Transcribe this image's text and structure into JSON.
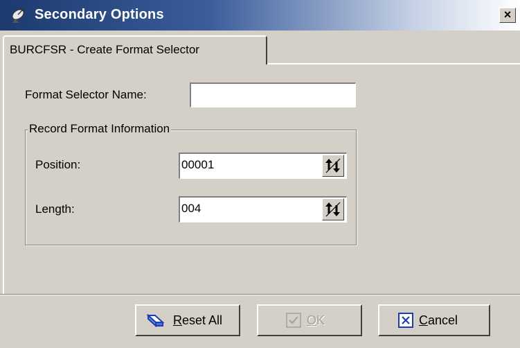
{
  "window": {
    "title": "Secondary Options",
    "close_glyph": "×"
  },
  "tab": {
    "label": "BURCFSR - Create Format Selector"
  },
  "form": {
    "format_selector_name_label": "Format Selector Name:",
    "format_selector_name_value": "",
    "group_title": "Record Format Information",
    "position_label": "Position:",
    "position_value": "00001",
    "length_label": "Length:",
    "length_value": "004"
  },
  "buttons": {
    "reset_mnemonic": "R",
    "reset_rest": "eset All",
    "ok_mnemonic": "O",
    "ok_rest": "K",
    "cancel_mnemonic": "C",
    "cancel_rest": "ancel",
    "ok_enabled": false
  },
  "icons": {
    "title": "satellite-dish-icon",
    "reset": "eraser-icon",
    "ok": "checkmark-icon",
    "cancel": "x-box-icon",
    "spin": "up-down-arrows-icon"
  },
  "colors": {
    "dialog_background": "#d4d0c8",
    "titlebar_start": "#1c3a6e",
    "titlebar_end": "#ffffff",
    "disabled_text": "#a0a0a0",
    "icon_blue": "#1c3fb0"
  }
}
